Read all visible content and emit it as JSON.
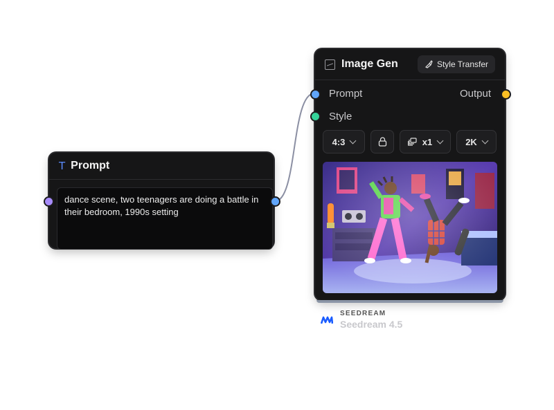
{
  "prompt_node": {
    "title": "Prompt",
    "text": "dance scene, two teenagers are doing a battle in their bedroom, 1990s setting"
  },
  "image_node": {
    "title": "Image Gen",
    "style_transfer_label": "Style Transfer",
    "inputs": [
      "Prompt",
      "Style"
    ],
    "output_label": "Output",
    "aspect_ratio": "4:3",
    "count": "x1",
    "resolution": "2K"
  },
  "model": {
    "brand": "SEEDREAM",
    "name": "Seedream 4.5"
  },
  "colors": {
    "prompt_port": "#a78bfa",
    "style_port": "#34d399",
    "output_port": "#fbbf24",
    "wire": "#8b8fa3"
  }
}
